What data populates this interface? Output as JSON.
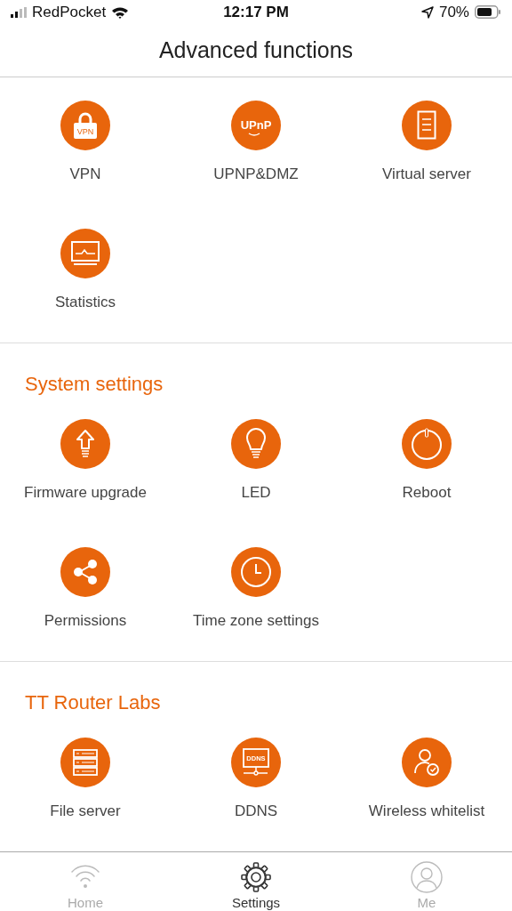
{
  "status_bar": {
    "carrier": "RedPocket",
    "time": "12:17 PM",
    "battery": "70%"
  },
  "header": {
    "title": "Advanced functions"
  },
  "sections": [
    {
      "items": [
        {
          "label": "VPN",
          "badge": "VPN"
        },
        {
          "label": "UPNP&DMZ",
          "badge": "UPnP"
        },
        {
          "label": "Virtual server"
        },
        {
          "label": "Statistics"
        }
      ]
    },
    {
      "title": "System settings",
      "items": [
        {
          "label": "Firmware upgrade"
        },
        {
          "label": "LED"
        },
        {
          "label": "Reboot"
        },
        {
          "label": "Permissions"
        },
        {
          "label": "Time zone settings"
        }
      ]
    },
    {
      "title": "TT Router Labs",
      "items": [
        {
          "label": "File server"
        },
        {
          "label": "DDNS",
          "badge": "DDNS"
        },
        {
          "label": "Wireless whitelist"
        }
      ]
    }
  ],
  "tab_bar": [
    {
      "label": "Home",
      "selected": false
    },
    {
      "label": "Settings",
      "selected": true
    },
    {
      "label": "Me",
      "selected": false
    }
  ]
}
